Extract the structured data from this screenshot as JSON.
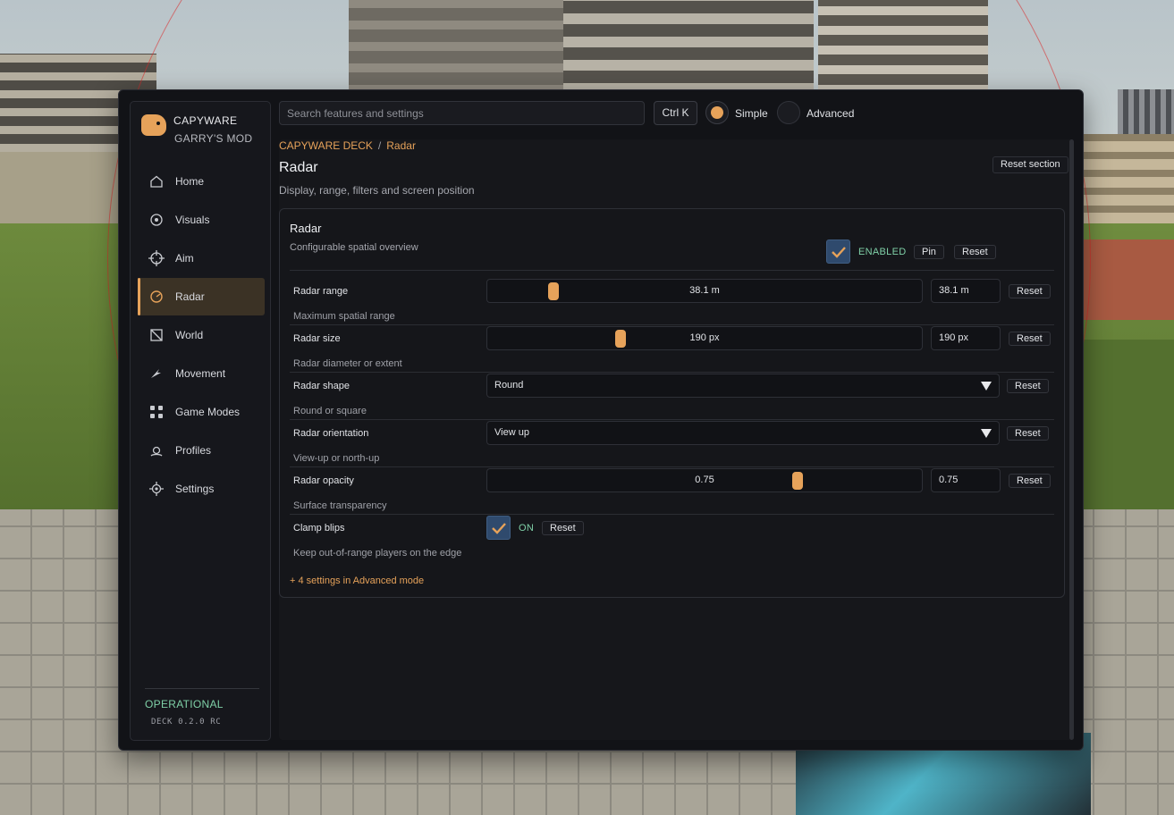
{
  "app": {
    "brand": "CAPYWARE",
    "game": "GARRY'S MOD",
    "status": "OPERATIONAL",
    "version": "DECK 0.2.0 RC"
  },
  "nav": [
    {
      "label": "Home",
      "icon": "home-icon"
    },
    {
      "label": "Visuals",
      "icon": "eye-icon"
    },
    {
      "label": "Aim",
      "icon": "crosshair-icon"
    },
    {
      "label": "Radar",
      "icon": "radar-icon",
      "active": true
    },
    {
      "label": "World",
      "icon": "world-icon"
    },
    {
      "label": "Movement",
      "icon": "movement-icon"
    },
    {
      "label": "Game Modes",
      "icon": "grid-icon"
    },
    {
      "label": "Profiles",
      "icon": "profile-icon"
    },
    {
      "label": "Settings",
      "icon": "gear-icon"
    }
  ],
  "topbar": {
    "search_placeholder": "Search features and settings",
    "shortcut": "Ctrl K",
    "mode_simple": "Simple",
    "mode_advanced": "Advanced",
    "mode_selected": "Simple"
  },
  "breadcrumb": {
    "root": "CAPYWARE DECK",
    "separator": "/",
    "current": "Radar"
  },
  "page": {
    "title": "Radar",
    "subtitle": "Display, range, filters and screen position",
    "reset_section": "Reset section"
  },
  "card": {
    "title": "Radar",
    "subtitle": "Configurable spatial overview",
    "enabled_label": "ENABLED",
    "enabled": true,
    "pin_label": "Pin",
    "reset_label": "Reset",
    "rows": [
      {
        "label": "Radar range",
        "value": "38.1 m",
        "input": "38.1 m",
        "fraction": 0.153,
        "description": "Maximum spatial range",
        "reset": "Reset"
      },
      {
        "label": "Radar size",
        "value": "190 px",
        "input": "190 px",
        "fraction": 0.306,
        "description": "Radar diameter or extent",
        "reset": "Reset"
      },
      {
        "label": "Radar shape",
        "selected": "Round",
        "description": "Round or square",
        "reset": "Reset"
      },
      {
        "label": "Radar orientation",
        "selected": "View up",
        "description": "View-up or north-up",
        "reset": "Reset"
      },
      {
        "label": "Radar opacity",
        "value": "0.75",
        "input": "0.75",
        "fraction": 0.714,
        "description": "Surface transparency",
        "reset": "Reset"
      },
      {
        "label": "Clamp blips",
        "toggle_label": "ON",
        "checked": true,
        "description": "Keep out-of-range players on the edge",
        "reset": "Reset"
      }
    ],
    "advanced_link": "+ 4 settings in Advanced mode"
  },
  "colors": {
    "accent": "#e6a25a",
    "status": "#7fd0a7",
    "checkbox": "#2f4a6d",
    "window_bg": "#121317"
  }
}
